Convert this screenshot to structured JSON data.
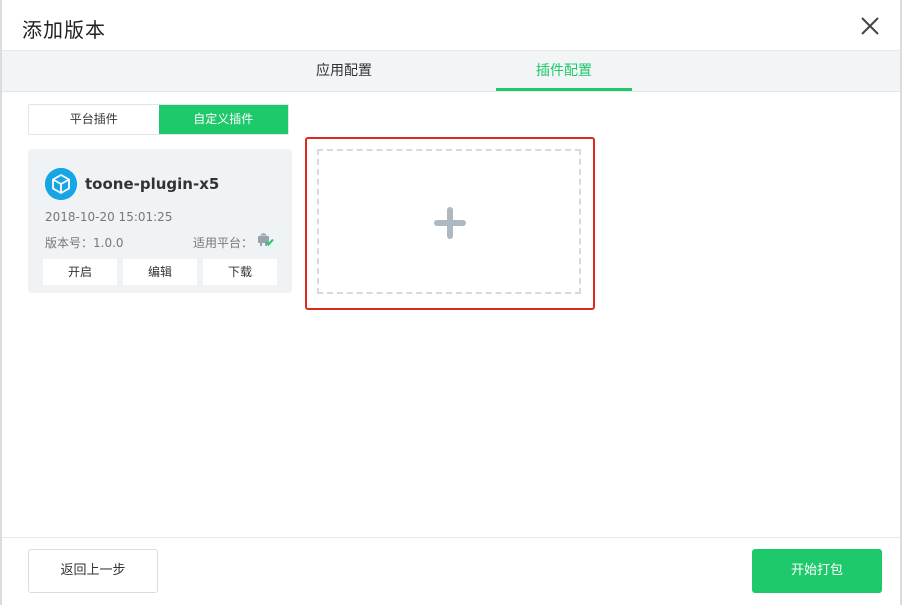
{
  "dialog": {
    "title": "添加版本"
  },
  "tabs": [
    {
      "label": "应用配置",
      "active": false
    },
    {
      "label": "插件配置",
      "active": true
    }
  ],
  "segment": {
    "options": [
      "平台插件",
      "自定义插件"
    ],
    "selected": "自定义插件"
  },
  "plugin": {
    "name": "toone-plugin-x5",
    "date": "2018-10-20 15:01:25",
    "version": "版本号：1.0.0",
    "platform_label": "适用平台：",
    "platform_icon": "android-check-icon",
    "actions": [
      "开启",
      "编辑",
      "下载"
    ]
  },
  "add_area": {
    "icon": "plus-icon",
    "highlight_color": "#e0291e"
  },
  "footer": {
    "back_label": "返回上一步",
    "start_label": "开始打包"
  },
  "colors": {
    "accent": "#1ec96b",
    "plugin_logo": "#17a5e6"
  }
}
